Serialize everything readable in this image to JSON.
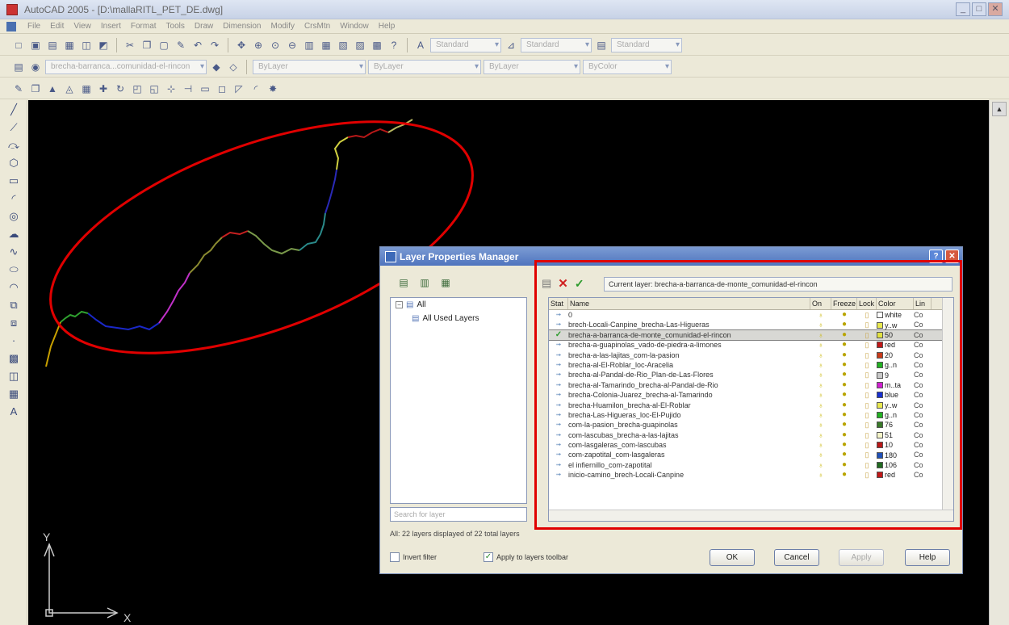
{
  "window": {
    "title": "AutoCAD 2005 - [D:\\mallaRITL_PET_DE.dwg]",
    "buttons": [
      "_",
      "□",
      "✕"
    ]
  },
  "menu": [
    "File",
    "Edit",
    "View",
    "Insert",
    "Format",
    "Tools",
    "Draw",
    "Dimension",
    "Modify",
    "CrsMtn",
    "Window",
    "Help"
  ],
  "toolbars": {
    "style1": "Standard",
    "style2": "Standard",
    "style3": "Standard",
    "layer_combo": "brecha-barranca...comunidad-el-rincon",
    "color_combo": "ByLayer",
    "linetype_combo": "ByLayer",
    "lineweight_combo": "ByLayer",
    "plotstyle_combo": "ByColor"
  },
  "canvas": {
    "ucs_x": "X",
    "ucs_y": "Y"
  },
  "dialog": {
    "title": "Layer Properties Manager",
    "tree_root": "All",
    "tree_child": "All Used Layers",
    "search_placeholder": "Search for layer",
    "status": "All: 22 layers displayed of 22 total layers",
    "invert_filter": "Invert filter",
    "apply_toolbar": "Apply to layers toolbar",
    "current_layer": "Current layer: brecha-a-barranca-de-monte_comunidad-el-rincon",
    "columns": {
      "stat": "Stat",
      "name": "Name",
      "on": "On",
      "freeze": "Freeze",
      "lock": "Lock",
      "color": "Color",
      "linetype": "Lin"
    },
    "buttons": {
      "ok": "OK",
      "cancel": "Cancel",
      "apply": "Apply",
      "help": "Help"
    }
  },
  "layers": [
    {
      "name": "0",
      "color": "white",
      "hex": "#ffffff",
      "lt": "Co"
    },
    {
      "name": "brech-Locali-Canpine_brecha-Las-Higueras",
      "color": "y..w",
      "hex": "#e8e850",
      "lt": "Co"
    },
    {
      "name": "brecha-a-barranca-de-monte_comunidad-el-rincon",
      "color": "50",
      "hex": "#e0e040",
      "lt": "Co",
      "current": true
    },
    {
      "name": "brecha-a-guapinolas_vado-de-piedra-a-limones",
      "color": "red",
      "hex": "#c01818",
      "lt": "Co"
    },
    {
      "name": "brecha-a-las-lajitas_com-la-pasion",
      "color": "20",
      "hex": "#c83a1a",
      "lt": "Co"
    },
    {
      "name": "brecha-al-El-Roblar_loc-Aracelia",
      "color": "g..n",
      "hex": "#22b022",
      "lt": "Co"
    },
    {
      "name": "brecha-al-Pandal-de-Rio_Plan-de-Las-Flores",
      "color": "9",
      "hex": "#c8c8c8",
      "lt": "Co"
    },
    {
      "name": "brecha-al-Tamarindo_brecha-al-Pandal-de-Rio",
      "color": "m..ta",
      "hex": "#d020d0",
      "lt": "Co"
    },
    {
      "name": "brecha-Colonia-Juarez_brecha-al-Tamarindo",
      "color": "blue",
      "hex": "#1830d0",
      "lt": "Co"
    },
    {
      "name": "brecha-Huamilon_brecha-al-El-Roblar",
      "color": "y..w",
      "hex": "#e8e850",
      "lt": "Co"
    },
    {
      "name": "brecha-Las-Higueras_loc-El-Pujido",
      "color": "g..n",
      "hex": "#22b022",
      "lt": "Co"
    },
    {
      "name": "com-la-pasion_brecha-guapinolas",
      "color": "76",
      "hex": "#3a7a2a",
      "lt": "Co"
    },
    {
      "name": "com-lascubas_brecha-a-las-lajitas",
      "color": "51",
      "hex": "#f4f4c8",
      "lt": "Co"
    },
    {
      "name": "com-lasgaleras_com-lascubas",
      "color": "10",
      "hex": "#b81818",
      "lt": "Co"
    },
    {
      "name": "com-zapotital_com-lasgaleras",
      "color": "180",
      "hex": "#2050b8",
      "lt": "Co"
    },
    {
      "name": "el infiernillo_com-zapotital",
      "color": "106",
      "hex": "#206a20",
      "lt": "Co"
    },
    {
      "name": "inicio-camino_brech-Locali-Canpine",
      "color": "red",
      "hex": "#c01818",
      "lt": "Co"
    }
  ]
}
